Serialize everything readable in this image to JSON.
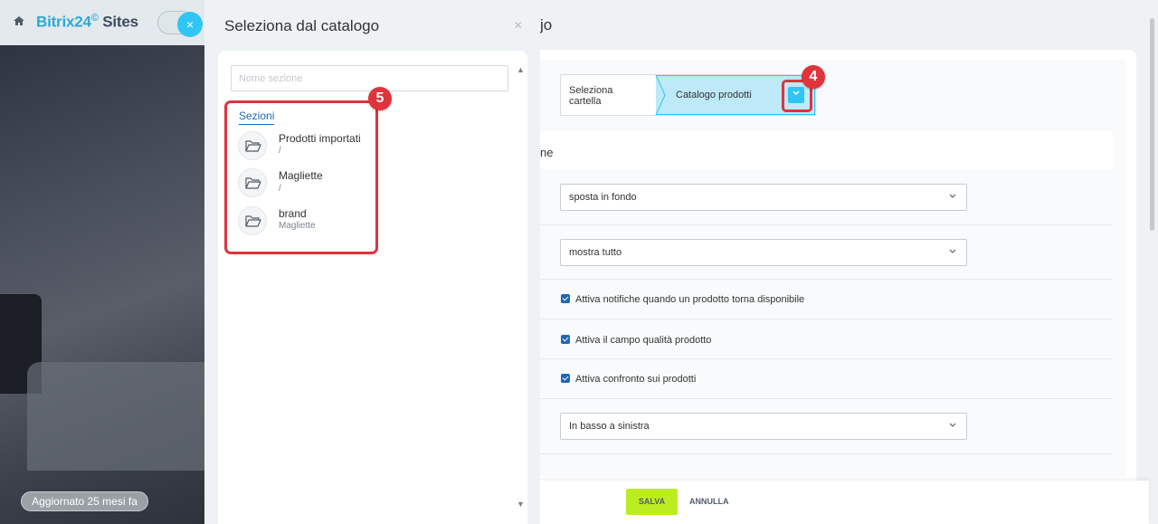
{
  "background_site": {
    "brand_name": "Bitrix24",
    "brand_suffix": "Sites",
    "brand_clock": "©",
    "close_symbol": "×",
    "updated_badge": "Aggiornato 25 mesi fa"
  },
  "catalog_slider": {
    "title": "Seleziona dal catalogo",
    "close_symbol": "×",
    "search_placeholder": "Nome sezione",
    "tab_label": "Sezioni",
    "sections": [
      {
        "name": "Prodotti importati",
        "path": "/"
      },
      {
        "name": "Magliette",
        "path": "/"
      },
      {
        "name": "brand",
        "path": "Magliette"
      }
    ],
    "annotation_number": "5"
  },
  "settings": {
    "title_fragment": "jo",
    "breadcrumb_first": "Seleziona\ncartella",
    "breadcrumb_first_line1": "Seleziona",
    "breadcrumb_first_line2": "cartella",
    "breadcrumb_active": "Catalogo prodotti",
    "annotation_number": "4",
    "section_label_fragment": "ne",
    "select_1": "sposta in fondo",
    "select_2": "mostra tutto",
    "checkbox_1": "Attiva notifiche quando un prodotto torna disponibile",
    "checkbox_2": "Attiva il campo qualità prodotto",
    "checkbox_3": "Attiva confronto sui prodotti",
    "select_3": "In basso a sinistra",
    "save_label": "SALVA",
    "cancel_label": "ANNULLA"
  },
  "colors": {
    "accent": "#2fc6f6",
    "highlight": "#e0333c",
    "save_button": "#bbed21",
    "link": "#2067b0"
  }
}
